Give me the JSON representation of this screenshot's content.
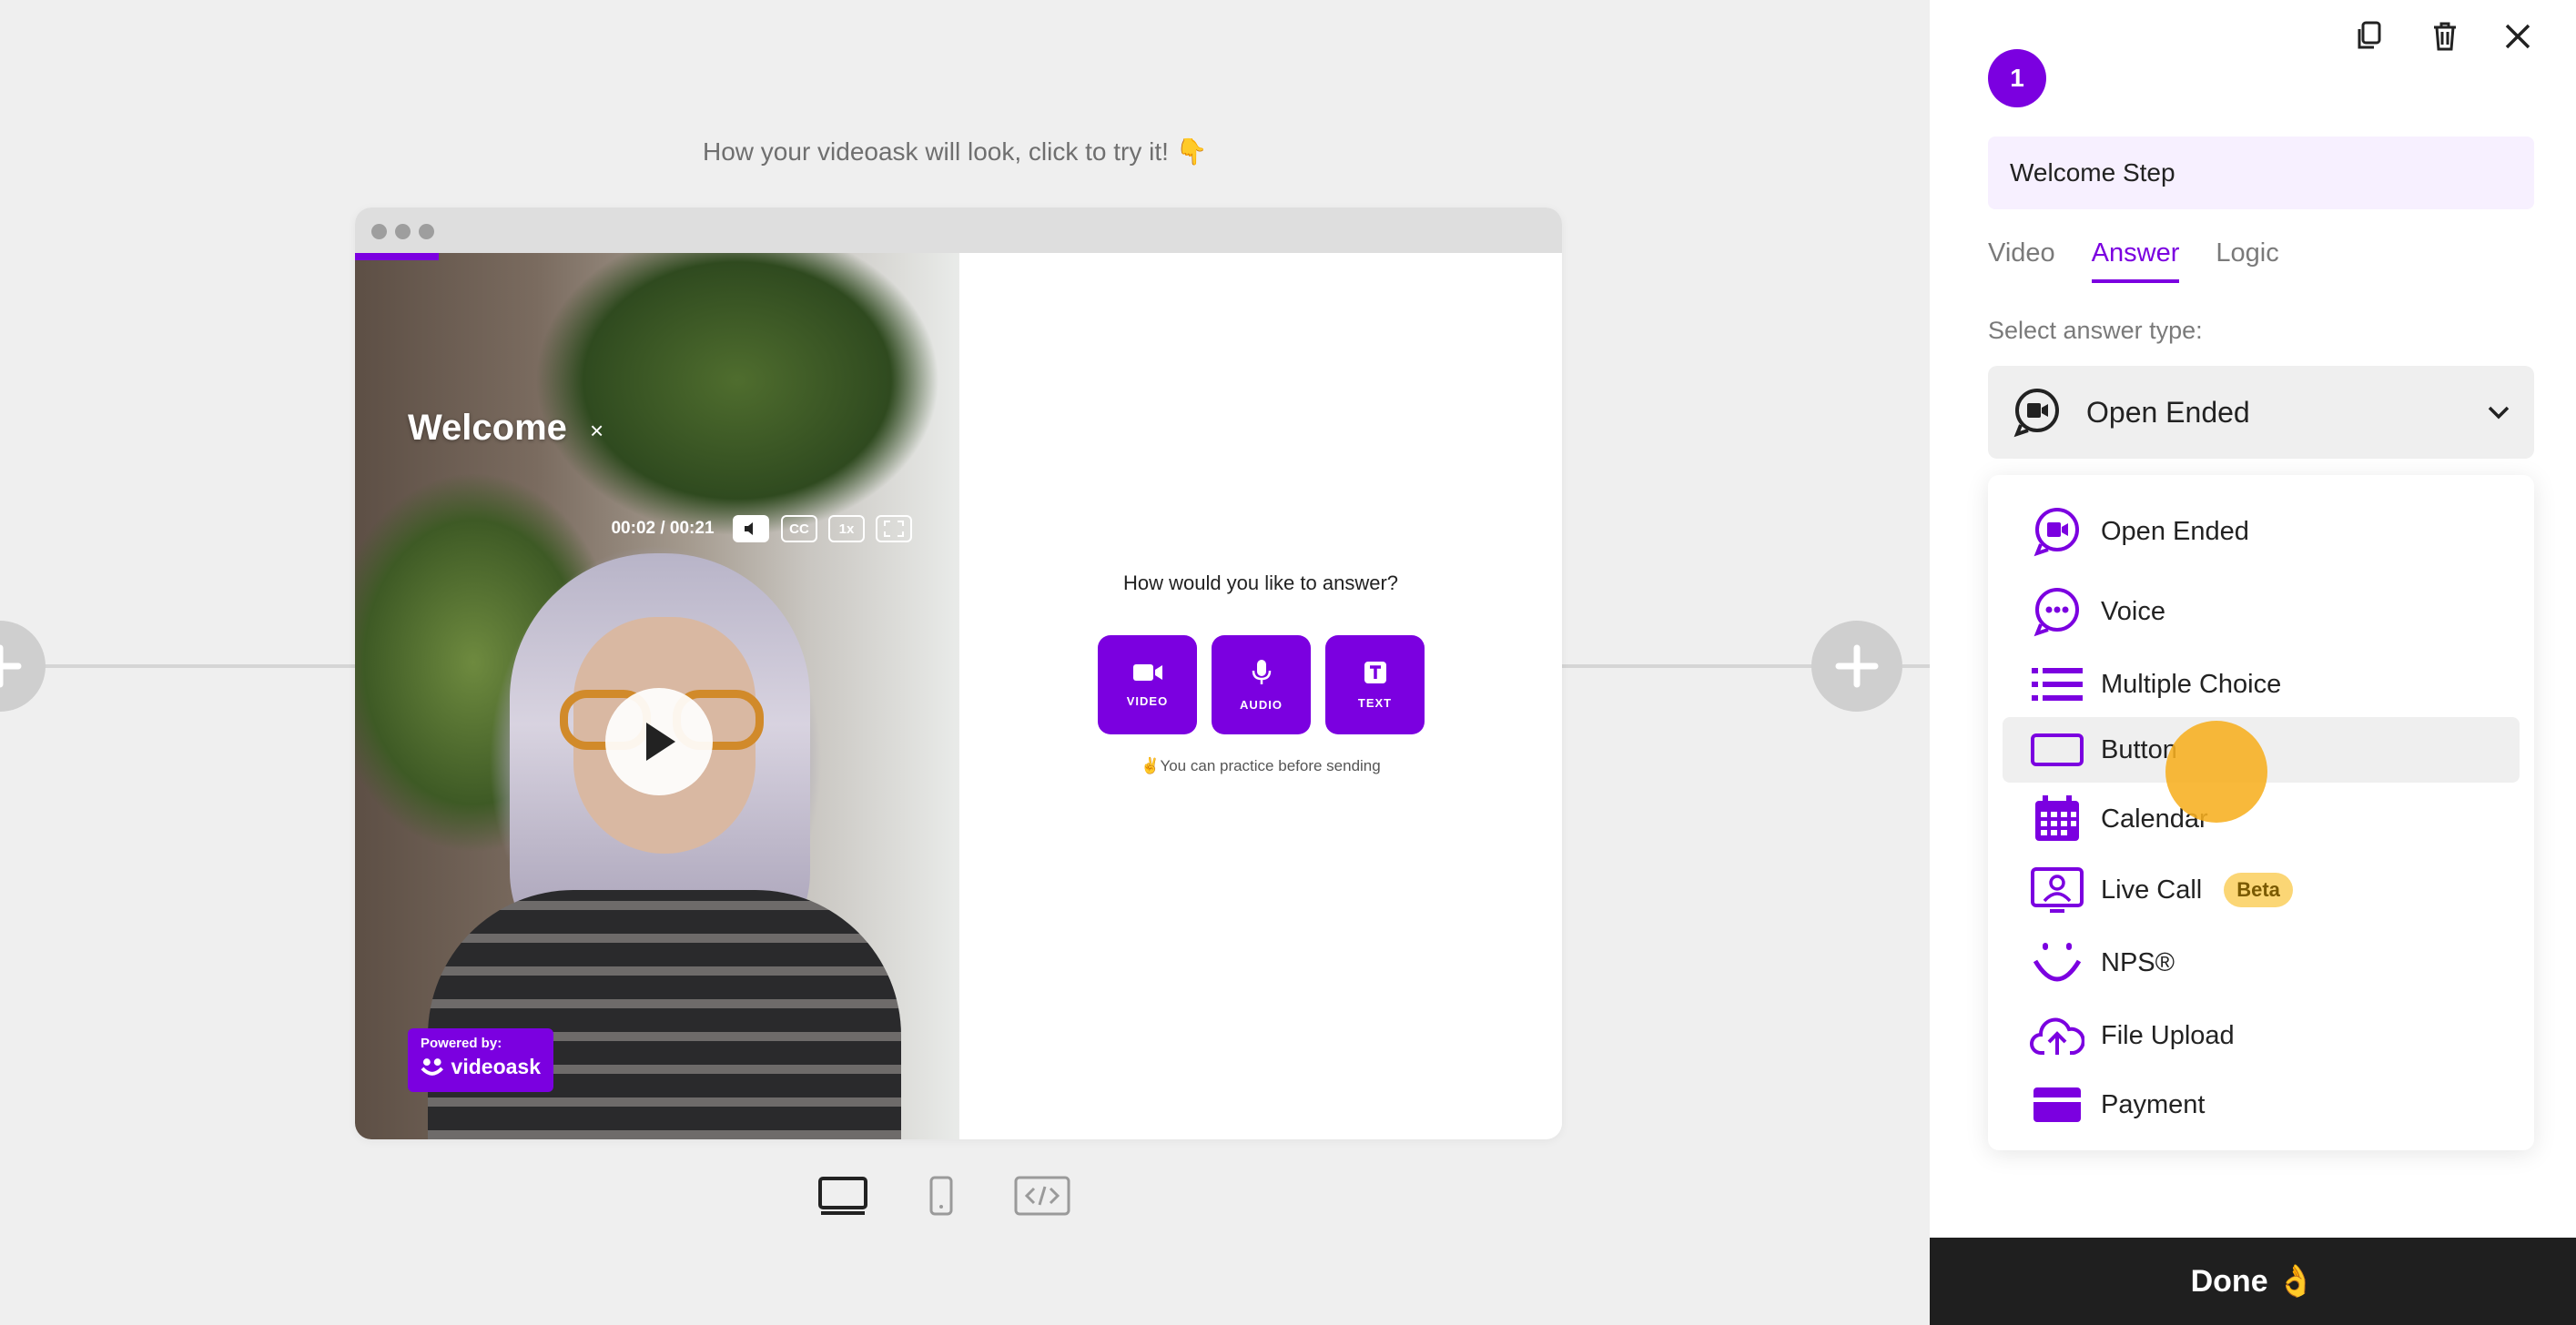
{
  "canvas": {
    "hint": "How your videoask will look, click to try it! 👇",
    "add_node_icon": "plus-icon"
  },
  "preview": {
    "time": "00:02 / 00:21",
    "controls": {
      "cc": "CC",
      "speed": "1x"
    },
    "welcome_title": "Welcome",
    "welcome_close": "×",
    "powered_by_label": "Powered by:",
    "powered_by_brand": "videoask",
    "question": "How would you like to answer?",
    "answer_buttons": [
      {
        "label": "VIDEO",
        "icon": "video-camera-icon"
      },
      {
        "label": "AUDIO",
        "icon": "microphone-icon"
      },
      {
        "label": "TEXT",
        "icon": "text-icon"
      }
    ],
    "practice_note": "✌️You can practice before sending"
  },
  "view_toggles": [
    "desktop-icon",
    "mobile-icon",
    "embed-code-icon"
  ],
  "panel": {
    "step_number": "1",
    "step_title": "Welcome Step",
    "tabs": [
      {
        "label": "Video",
        "active": false
      },
      {
        "label": "Answer",
        "active": true
      },
      {
        "label": "Logic",
        "active": false
      }
    ],
    "select_label": "Select answer type:",
    "selected_type": "Open Ended",
    "options": [
      {
        "label": "Open Ended",
        "icon": "open-ended-icon"
      },
      {
        "label": "Voice",
        "icon": "voice-icon"
      },
      {
        "label": "Multiple Choice",
        "icon": "list-icon"
      },
      {
        "label": "Button",
        "icon": "button-icon",
        "highlighted": true
      },
      {
        "label": "Calendar",
        "icon": "calendar-icon"
      },
      {
        "label": "Live Call",
        "icon": "live-call-icon",
        "badge": "Beta"
      },
      {
        "label": "NPS®",
        "icon": "smile-icon"
      },
      {
        "label": "File Upload",
        "icon": "cloud-upload-icon"
      },
      {
        "label": "Payment",
        "icon": "credit-card-icon"
      }
    ],
    "done_label": "Done 👌"
  },
  "colors": {
    "accent": "#7b00e0",
    "beta_badge": "#fbd675",
    "done_bar": "#1f1f1f",
    "cursor": "#f7af20"
  }
}
